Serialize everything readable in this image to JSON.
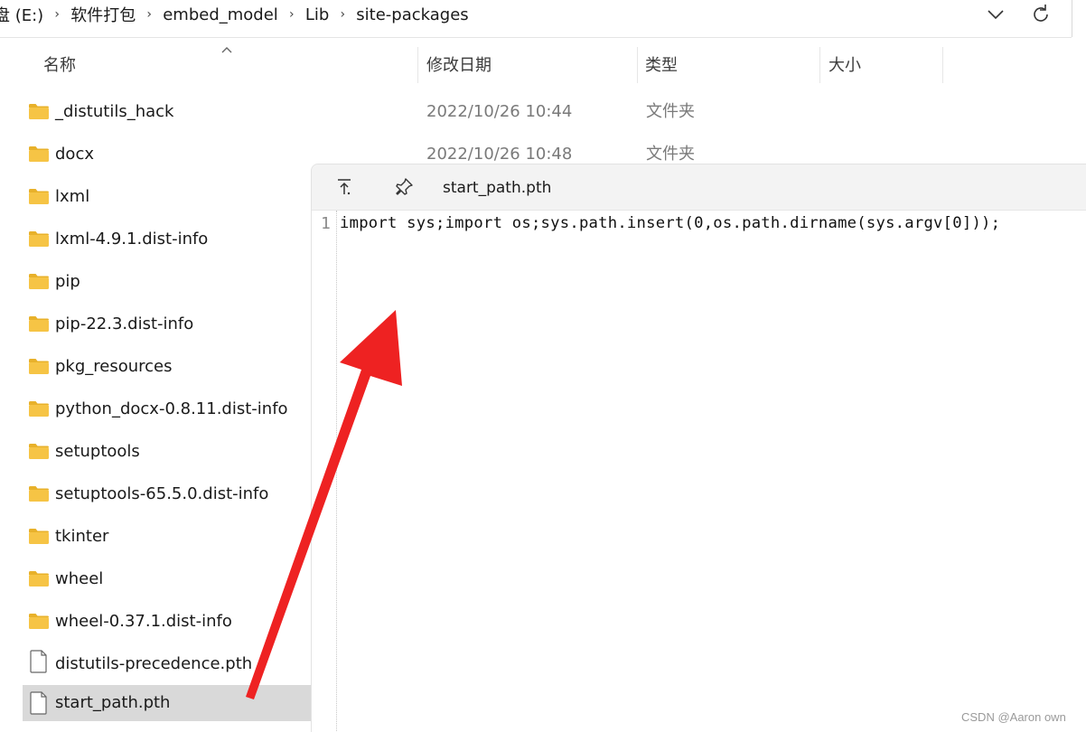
{
  "address_bar": {
    "crumbs": [
      "盘 (E:)",
      "软件打包",
      "embed_model",
      "Lib",
      "site-packages"
    ],
    "separator": "›",
    "dropdown_icon": "chevron-down-icon",
    "refresh_icon": "refresh-icon"
  },
  "columns": {
    "name": "名称",
    "date": "修改日期",
    "type": "类型",
    "size": "大小",
    "sorted_by": "name",
    "sort_icon": "sort-ascending-icon"
  },
  "files": [
    {
      "name": "_distutils_hack",
      "date": "2022/10/26 10:44",
      "type": "文件夹",
      "kind": "folder"
    },
    {
      "name": "docx",
      "date": "2022/10/26 10:48",
      "type": "文件夹",
      "kind": "folder"
    },
    {
      "name": "lxml",
      "date": "",
      "type": "",
      "kind": "folder"
    },
    {
      "name": "lxml-4.9.1.dist-info",
      "date": "",
      "type": "",
      "kind": "folder"
    },
    {
      "name": "pip",
      "date": "",
      "type": "",
      "kind": "folder"
    },
    {
      "name": "pip-22.3.dist-info",
      "date": "",
      "type": "",
      "kind": "folder"
    },
    {
      "name": "pkg_resources",
      "date": "",
      "type": "",
      "kind": "folder"
    },
    {
      "name": "python_docx-0.8.11.dist-info",
      "date": "",
      "type": "",
      "kind": "folder"
    },
    {
      "name": "setuptools",
      "date": "",
      "type": "",
      "kind": "folder"
    },
    {
      "name": "setuptools-65.5.0.dist-info",
      "date": "",
      "type": "",
      "kind": "folder"
    },
    {
      "name": "tkinter",
      "date": "",
      "type": "",
      "kind": "folder"
    },
    {
      "name": "wheel",
      "date": "",
      "type": "",
      "kind": "folder"
    },
    {
      "name": "wheel-0.37.1.dist-info",
      "date": "",
      "type": "",
      "kind": "folder"
    },
    {
      "name": "distutils-precedence.pth",
      "date": "",
      "type": "",
      "kind": "file"
    },
    {
      "name": "start_path.pth",
      "date": "",
      "type": "",
      "kind": "file",
      "selected": true
    }
  ],
  "preview": {
    "title": "start_path.pth",
    "open_icon": "open-external-icon",
    "pin_icon": "pin-icon",
    "lines": [
      {
        "number": "1",
        "text": "import sys;import os;sys.path.insert(0,os.path.dirname(sys.argv[0]));"
      }
    ]
  },
  "annotation": {
    "arrow_color": "#ee2222"
  },
  "watermark": "CSDN @Aaron own",
  "colors": {
    "folder": "#f6c445",
    "folder_dark": "#e8b12a",
    "selected_row": "#d9d9d9",
    "preview_bg": "#f7f7f7"
  }
}
